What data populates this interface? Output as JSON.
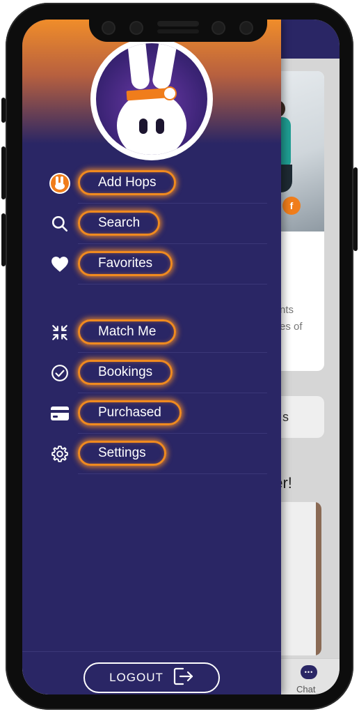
{
  "drawer": {
    "menu_primary": [
      {
        "label": "Add Hops",
        "icon": "hops-logo-icon"
      },
      {
        "label": "Search",
        "icon": "search-icon"
      },
      {
        "label": "Favorites",
        "icon": "heart-icon"
      }
    ],
    "menu_secondary": [
      {
        "label": "Match Me",
        "icon": "match-arrows-icon"
      },
      {
        "label": "Bookings",
        "icon": "check-circle-icon"
      },
      {
        "label": "Purchased",
        "icon": "credit-card-icon"
      },
      {
        "label": "Settings",
        "icon": "gear-icon"
      }
    ],
    "logout_label": "LOGOUT"
  },
  "background": {
    "card_text_line1": "nts",
    "card_text_line2": "es of",
    "card2_text": "s",
    "heading_fragment": "ner!",
    "tab_chat_label": "Chat"
  },
  "colors": {
    "drawer_bg": "#2a2665",
    "highlight": "#f08a1f",
    "header_gradient_top": "#f08d2a"
  }
}
